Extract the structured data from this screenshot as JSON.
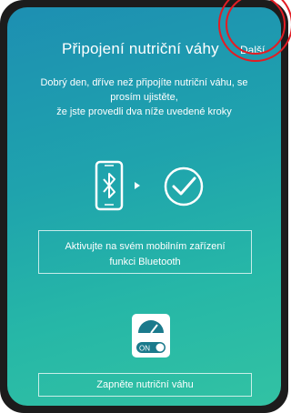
{
  "header": {
    "title": "Připojení nutriční váhy",
    "next_label": "Další"
  },
  "intro": {
    "line1": "Dobrý den, dříve než připojíte nutriční váhu, se",
    "line2": "prosím ujistěte,",
    "line3": "že jste provedli dva níže uvedené kroky"
  },
  "step_bluetooth": {
    "line1": "Aktivujte na svém mobilním zařízení",
    "line2": "funkci Bluetooth"
  },
  "step_scale": {
    "label": "Zapněte nutriční váhu",
    "switch_label": "ON"
  },
  "colors": {
    "gradient_top": "#1d8fb2",
    "gradient_bottom": "#32c2a3",
    "highlight_ring": "#e21d24"
  }
}
